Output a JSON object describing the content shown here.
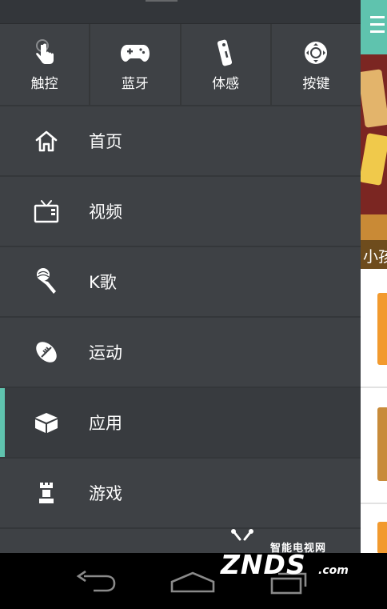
{
  "drawer": {
    "controls": [
      {
        "label": "触控",
        "icon": "touch-hand-icon"
      },
      {
        "label": "蓝牙",
        "icon": "gamepad-icon"
      },
      {
        "label": "体感",
        "icon": "motion-remote-icon"
      },
      {
        "label": "按键",
        "icon": "dpad-icon"
      }
    ],
    "nav": [
      {
        "label": "首页",
        "icon": "home-icon",
        "active": false
      },
      {
        "label": "视频",
        "icon": "tv-icon",
        "active": false
      },
      {
        "label": "K歌",
        "icon": "microphone-icon",
        "active": false
      },
      {
        "label": "运动",
        "icon": "football-icon",
        "active": false
      },
      {
        "label": "应用",
        "icon": "box-icon",
        "active": true
      },
      {
        "label": "游戏",
        "icon": "chess-rook-icon",
        "active": false
      }
    ]
  },
  "background_app": {
    "caption": "小孩"
  },
  "watermark": {
    "small": "智能电视网",
    "big": "ZNDS",
    "suffix": ".com"
  },
  "colors": {
    "accent": "#5fc3ae",
    "drawer_bg": "#3e4145",
    "active_bg": "#383b3f"
  }
}
